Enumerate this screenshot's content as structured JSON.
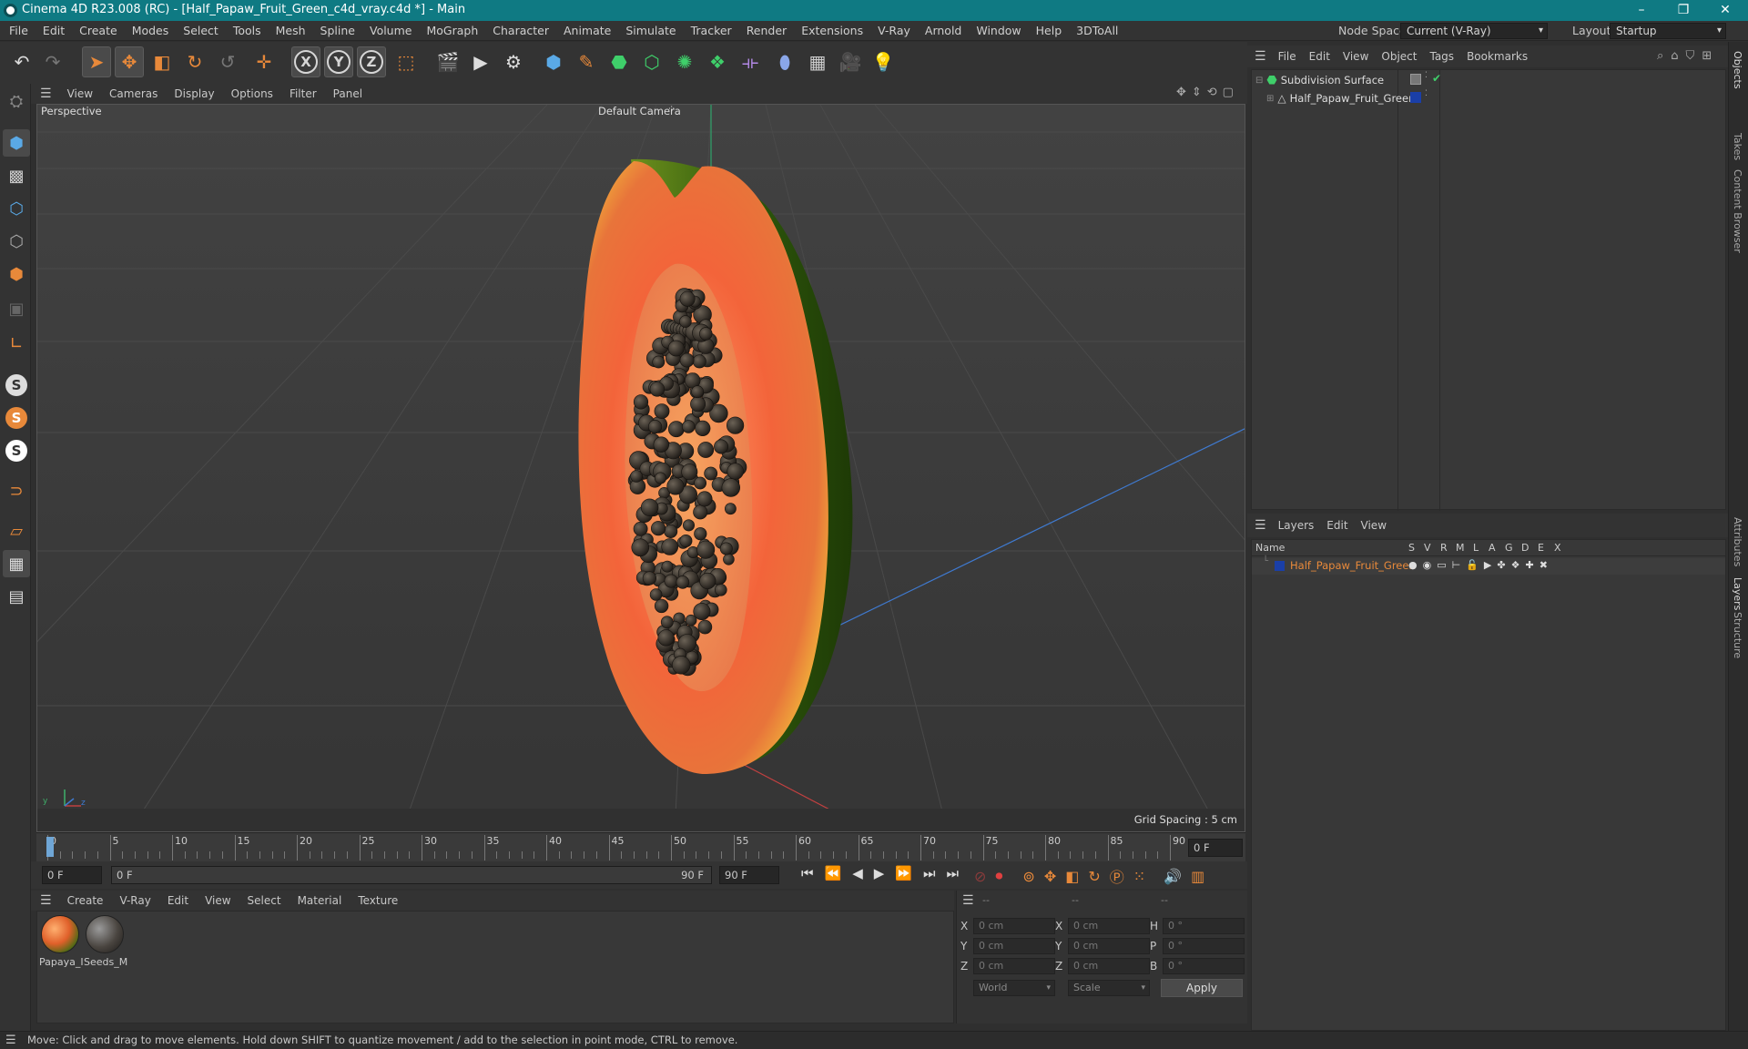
{
  "window": {
    "title": "Cinema 4D R23.008 (RC) - [Half_Papaw_Fruit_Green_c4d_vray.c4d *] - Main",
    "minimize": "–",
    "maximize": "❐",
    "close": "✕"
  },
  "menubar": {
    "items": [
      "File",
      "Edit",
      "Create",
      "Modes",
      "Select",
      "Tools",
      "Mesh",
      "Spline",
      "Volume",
      "MoGraph",
      "Character",
      "Animate",
      "Simulate",
      "Tracker",
      "Render",
      "Extensions",
      "V-Ray",
      "Arnold",
      "Window",
      "Help",
      "3DToAll"
    ],
    "node_space_label": "Node Space:",
    "node_space_value": "Current (V-Ray)",
    "layout_label": "Layout:",
    "layout_value": "Startup"
  },
  "toolbar": {
    "axis_x": "X",
    "axis_y": "Y",
    "axis_z": "Z"
  },
  "viewport": {
    "menu": [
      "View",
      "Cameras",
      "Display",
      "Options",
      "Filter",
      "Panel"
    ],
    "projection": "Perspective",
    "camera": "Default Camera",
    "grid_spacing": "Grid Spacing : 5 cm"
  },
  "timeline": {
    "ticks": [
      "0",
      "5",
      "10",
      "15",
      "20",
      "25",
      "30",
      "35",
      "40",
      "45",
      "50",
      "55",
      "60",
      "65",
      "70",
      "75",
      "80",
      "85",
      "90"
    ],
    "current_frame": "0 F",
    "start_field": "0 F",
    "range_start": "0 F",
    "range_end": "90 F",
    "end_field": "90 F"
  },
  "materials": {
    "menu": [
      "Create",
      "V-Ray",
      "Edit",
      "View",
      "Select",
      "Material",
      "Texture"
    ],
    "items": [
      {
        "label": "Papaya_I"
      },
      {
        "label": "Seeds_M"
      }
    ]
  },
  "coordinates": {
    "headers": [
      "--",
      "--",
      "--"
    ],
    "rows": [
      {
        "a": "X",
        "av": "0 cm",
        "b": "X",
        "bv": "0 cm",
        "c": "H",
        "cv": "0 °"
      },
      {
        "a": "Y",
        "av": "0 cm",
        "b": "Y",
        "bv": "0 cm",
        "c": "P",
        "cv": "0 °"
      },
      {
        "a": "Z",
        "av": "0 cm",
        "b": "Z",
        "bv": "0 cm",
        "c": "B",
        "cv": "0 °"
      }
    ],
    "space": "World",
    "mode": "Scale",
    "apply": "Apply"
  },
  "objects": {
    "menu": [
      "File",
      "Edit",
      "View",
      "Object",
      "Tags",
      "Bookmarks"
    ],
    "tree": [
      {
        "name": "Subdivision Surface"
      },
      {
        "name": "Half_Papaw_Fruit_Green"
      }
    ]
  },
  "layers": {
    "menu": [
      "Layers",
      "Edit",
      "View"
    ],
    "columns": [
      "Name",
      "S",
      "V",
      "R",
      "M",
      "L",
      "A",
      "G",
      "D",
      "E",
      "X"
    ],
    "rows": [
      {
        "name": "Half_Papaw_Fruit_Green"
      }
    ]
  },
  "sidetabs": [
    "Objects",
    "Takes",
    "Content Browser",
    "Attributes",
    "Layers",
    "Structure"
  ],
  "status": "Move: Click and drag to move elements. Hold down SHIFT to quantize movement / add to the selection in point mode, CTRL to remove.",
  "colors": {
    "titlebar": "#0f7a83",
    "accent_orange": "#e8893a",
    "layer_blue": "#1a3fa8",
    "papaya_flesh": "#f06a3a",
    "papaya_skin": "#3d6b12"
  }
}
